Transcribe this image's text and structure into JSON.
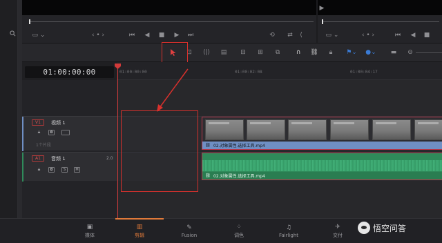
{
  "timecode": "01:00:00:00",
  "ruler_ticks": [
    "01:00:00:00",
    "01:00:02:08",
    "01:00:04:17"
  ],
  "tracks": {
    "v1": {
      "badge": "V1",
      "name": "视频 1",
      "clip_count": "1个片段"
    },
    "a1": {
      "badge": "A1",
      "name": "音频 1",
      "channels": "2.0",
      "solo_label": "S",
      "mute_label": "M"
    }
  },
  "clips": {
    "video_name": "02.对象属性.选择工具.mp4",
    "audio_name": "02.对象属性.选择工具.mp4"
  },
  "pages": [
    {
      "label": "媒体",
      "icon": "media-icon",
      "active": false
    },
    {
      "label": "剪辑",
      "icon": "edit-icon",
      "active": true
    },
    {
      "label": "Fusion",
      "icon": "fusion-icon",
      "active": false
    },
    {
      "label": "调色",
      "icon": "color-icon",
      "active": false
    },
    {
      "label": "Fairlight",
      "icon": "fairlight-icon",
      "active": false
    },
    {
      "label": "交付",
      "icon": "deliver-icon",
      "active": false
    }
  ],
  "watermark": "悟空问答",
  "colors": {
    "annotation": "#d8312d",
    "video_clip": "#6f8fc4",
    "audio_clip": "#2f8a5a",
    "active_page": "#e07a3a",
    "playhead": "#d23a3a"
  }
}
